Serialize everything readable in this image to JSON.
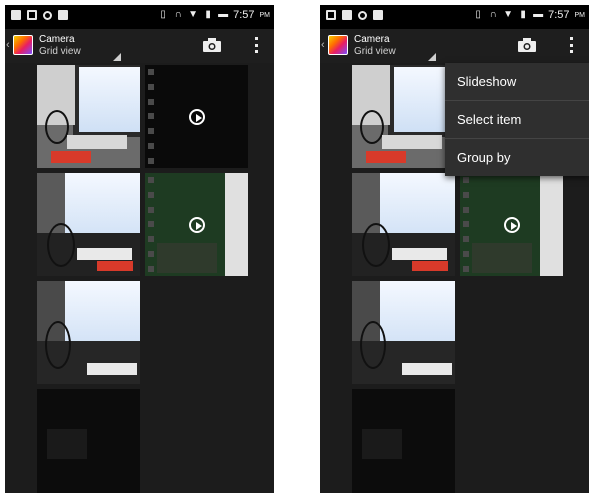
{
  "status_bar": {
    "time": "7:57",
    "ampm": "PM"
  },
  "action_bar": {
    "title": "Camera",
    "subtitle": "Grid view",
    "icons": [
      "back-chevron-icon",
      "camera-app-icon",
      "spinner-triangle-icon",
      "camera-icon",
      "overflow-menu-icon"
    ]
  },
  "grid": {
    "items": [
      {
        "kind": "photo"
      },
      {
        "kind": "video"
      },
      {
        "kind": "photo"
      },
      {
        "kind": "video"
      },
      {
        "kind": "photo"
      },
      {
        "kind": "photo"
      }
    ]
  },
  "overflow_menu": {
    "items": [
      "Slideshow",
      "Select item",
      "Group by"
    ]
  },
  "colors": {
    "background": "#1c1c1c",
    "status_bar": "#000000",
    "menu": "#2f2f2f"
  }
}
